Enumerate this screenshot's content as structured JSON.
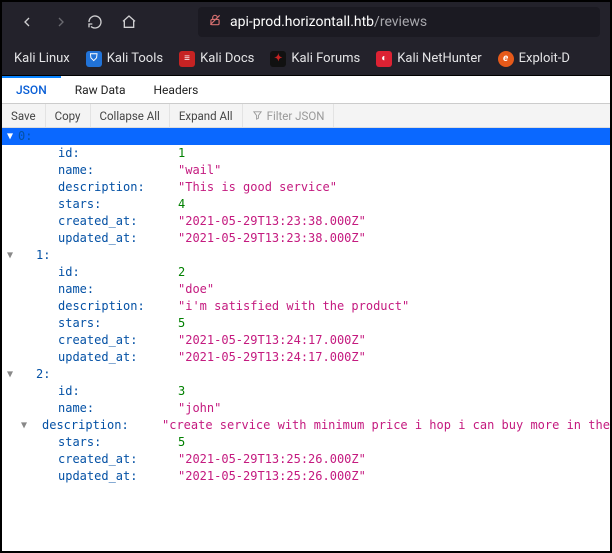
{
  "url": {
    "domain": "api-prod.horizontall.htb",
    "path": "/reviews"
  },
  "bookmarks": {
    "b0": "Kali Linux",
    "b1": "Kali Tools",
    "b2": "Kali Docs",
    "b3": "Kali Forums",
    "b4": "Kali NetHunter",
    "b5": "Exploit-D"
  },
  "viewer_tabs": {
    "json": "JSON",
    "raw": "Raw Data",
    "headers": "Headers"
  },
  "toolbar": {
    "save": "Save",
    "copy": "Copy",
    "collapse": "Collapse All",
    "expand": "Expand All",
    "filter_placeholder": "Filter JSON"
  },
  "field_labels": {
    "id": "id:",
    "name": "name:",
    "description": "description:",
    "stars": "stars:",
    "created_at": "created_at:",
    "updated_at": "updated_at:"
  },
  "records": [
    {
      "index_label": "0:",
      "id": "1",
      "name": "\"wail\"",
      "description": "\"This is good service\"",
      "stars": "4",
      "created_at": "\"2021-05-29T13:23:38.000Z\"",
      "updated_at": "\"2021-05-29T13:23:38.000Z\""
    },
    {
      "index_label": "1:",
      "id": "2",
      "name": "\"doe\"",
      "description": "\"i'm satisfied with the product\"",
      "stars": "5",
      "created_at": "\"2021-05-29T13:24:17.000Z\"",
      "updated_at": "\"2021-05-29T13:24:17.000Z\""
    },
    {
      "index_label": "2:",
      "id": "3",
      "name": "\"john\"",
      "description": "\"create service with minimum price i hop i can buy more in the futur\"",
      "stars": "5",
      "created_at": "\"2021-05-29T13:25:26.000Z\"",
      "updated_at": "\"2021-05-29T13:25:26.000Z\""
    }
  ]
}
